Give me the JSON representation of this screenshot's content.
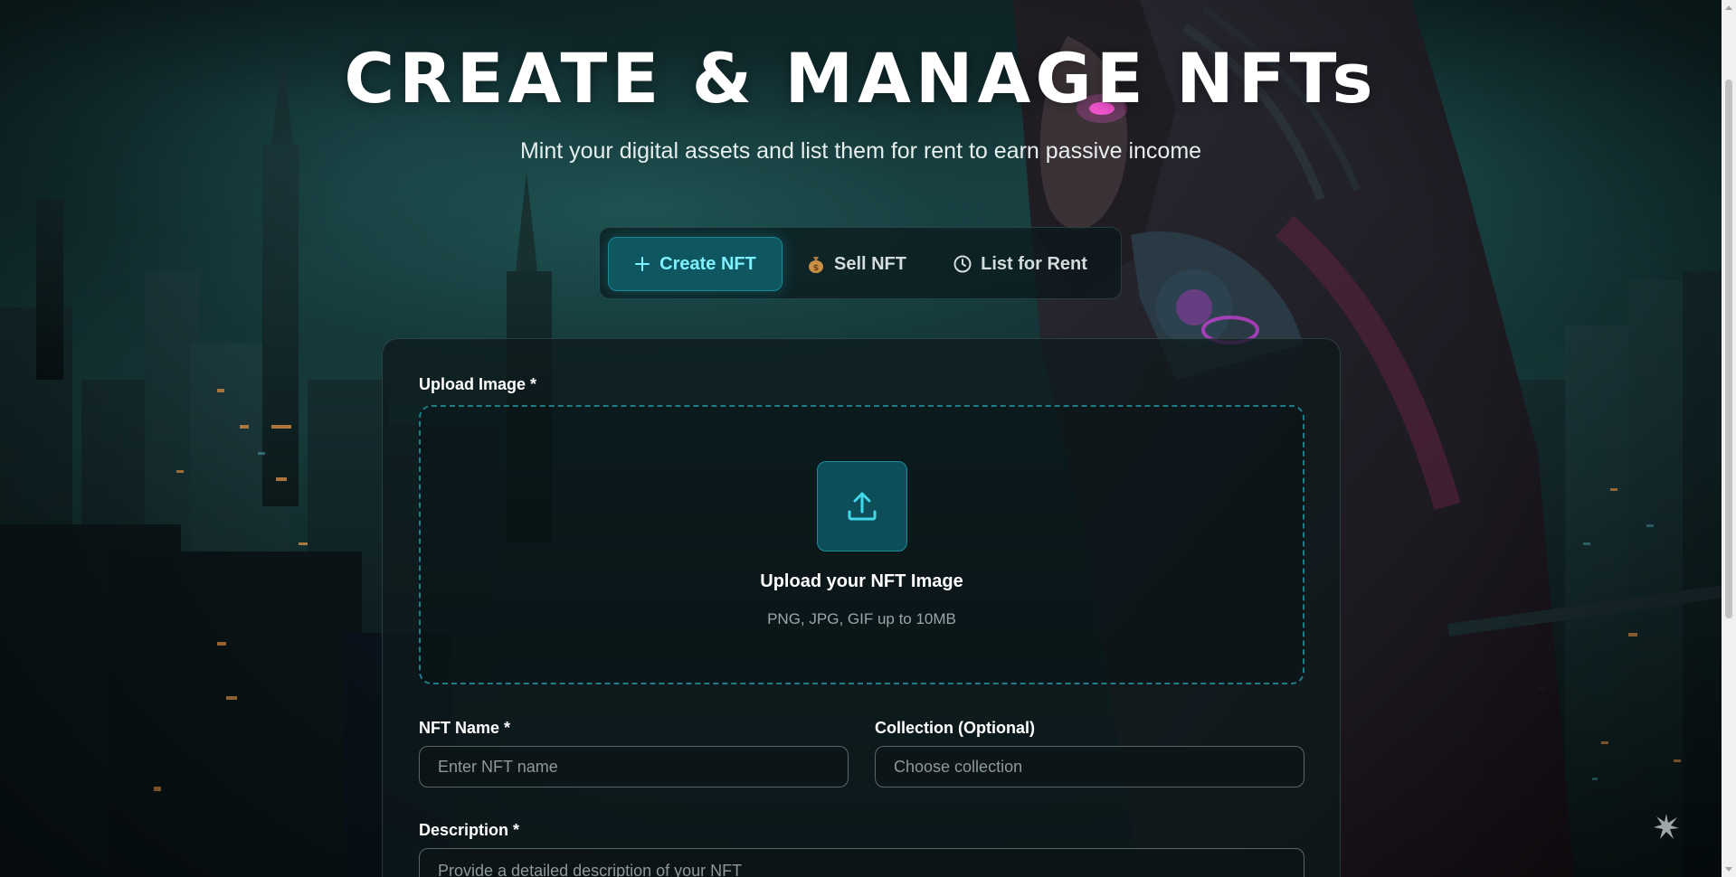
{
  "hero": {
    "title": "CREATE & MANAGE NFTs",
    "subtitle": "Mint your digital assets and list them for rent to earn passive income"
  },
  "tabs": [
    {
      "label": "Create NFT",
      "icon": "plus-icon",
      "active": true
    },
    {
      "label": "Sell NFT",
      "icon": "money-bag-icon",
      "icon_glyph": "💰",
      "active": false
    },
    {
      "label": "List for Rent",
      "icon": "clock-icon",
      "active": false
    }
  ],
  "form": {
    "upload": {
      "label": "Upload Image *",
      "title": "Upload your NFT Image",
      "hint": "PNG, JPG, GIF up to 10MB",
      "icon": "upload-icon"
    },
    "name": {
      "label": "NFT Name *",
      "placeholder": "Enter NFT name",
      "value": ""
    },
    "collection": {
      "label": "Collection (Optional)",
      "placeholder": "Choose collection",
      "value": ""
    },
    "description": {
      "label": "Description *",
      "placeholder": "Provide a detailed description of your NFT",
      "value": ""
    }
  },
  "colors": {
    "accent": "#7ff0ff",
    "accent_bg": "#0e5660",
    "accent_border": "#1b8b97"
  }
}
